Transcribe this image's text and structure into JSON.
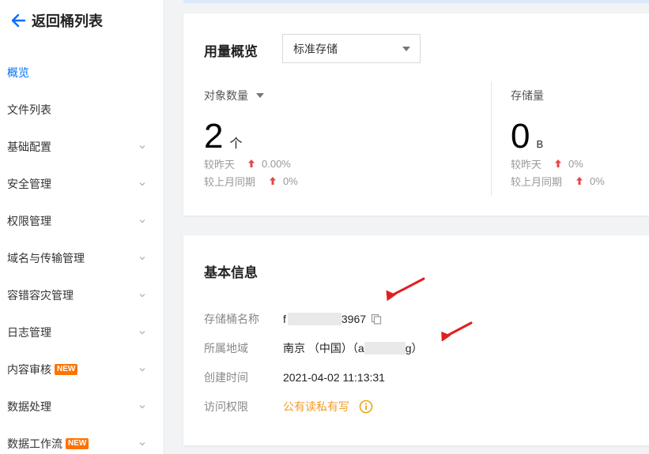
{
  "sidebar": {
    "back_label": "返回桶列表",
    "items": [
      {
        "label": "概览",
        "active": true,
        "chevron": false,
        "badge": ""
      },
      {
        "label": "文件列表",
        "active": false,
        "chevron": false,
        "badge": ""
      },
      {
        "label": "基础配置",
        "active": false,
        "chevron": true,
        "badge": ""
      },
      {
        "label": "安全管理",
        "active": false,
        "chevron": true,
        "badge": ""
      },
      {
        "label": "权限管理",
        "active": false,
        "chevron": true,
        "badge": ""
      },
      {
        "label": "域名与传输管理",
        "active": false,
        "chevron": true,
        "badge": ""
      },
      {
        "label": "容错容灾管理",
        "active": false,
        "chevron": true,
        "badge": ""
      },
      {
        "label": "日志管理",
        "active": false,
        "chevron": true,
        "badge": ""
      },
      {
        "label": "内容审核",
        "active": false,
        "chevron": true,
        "badge": "NEW"
      },
      {
        "label": "数据处理",
        "active": false,
        "chevron": true,
        "badge": ""
      },
      {
        "label": "数据工作流",
        "active": false,
        "chevron": true,
        "badge": "NEW"
      }
    ]
  },
  "usage": {
    "title": "用量概览",
    "storage_class": "标准存储",
    "objects": {
      "label": "对象数量",
      "value": "2",
      "unit": "个",
      "day_label": "较昨天",
      "day_value": "0.00%",
      "month_label": "较上月同期",
      "month_value": "0%"
    },
    "storage": {
      "label": "存储量",
      "value": "0",
      "unit": "B",
      "day_label": "较昨天",
      "day_value": "0%",
      "month_label": "较上月同期",
      "month_value": "0%"
    }
  },
  "basic_info": {
    "title": "基本信息",
    "bucket_name_label": "存储桶名称",
    "bucket_name_prefix": "f",
    "bucket_name_suffix": "3967",
    "region_label": "所属地域",
    "region_value_prefix": "南京 （中国）（a",
    "region_value_suffix": "g）",
    "created_label": "创建时间",
    "created_value": "2021-04-02 11:13:31",
    "access_label": "访问权限",
    "access_value": "公有读私有写"
  },
  "colors": {
    "accent": "#006eff",
    "new_badge": "#ff7200",
    "up_arrow": "#e54545",
    "annotation_arrow": "#e02020",
    "access_link": "#f29b24"
  }
}
